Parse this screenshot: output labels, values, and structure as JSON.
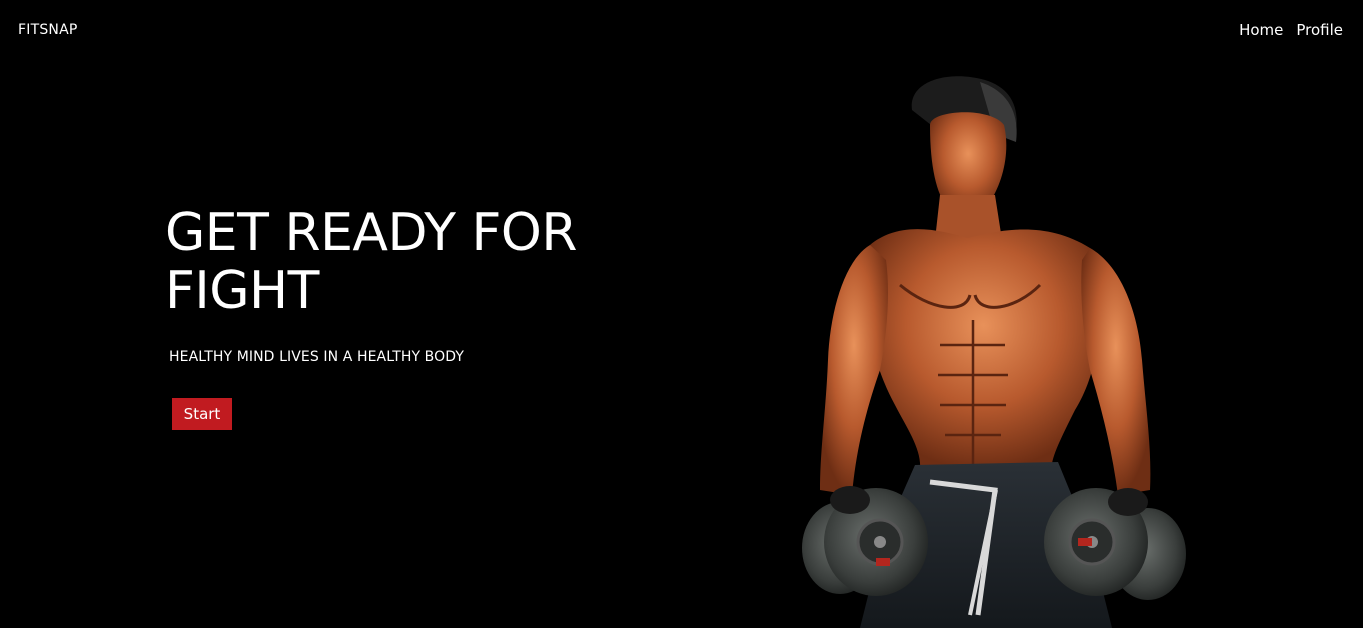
{
  "nav": {
    "brand": "FITSNAP",
    "links": [
      "Home",
      "Profile"
    ]
  },
  "hero": {
    "title": "GET READY FOR FIGHT",
    "subtitle": "HEALTHY MIND LIVES IN A HEALTHY BODY",
    "button_label": "Start",
    "image": "bodybuilder holding dumbbells"
  },
  "colors": {
    "background": "#000000",
    "text": "#ffffff",
    "accent": "#c11b20"
  }
}
